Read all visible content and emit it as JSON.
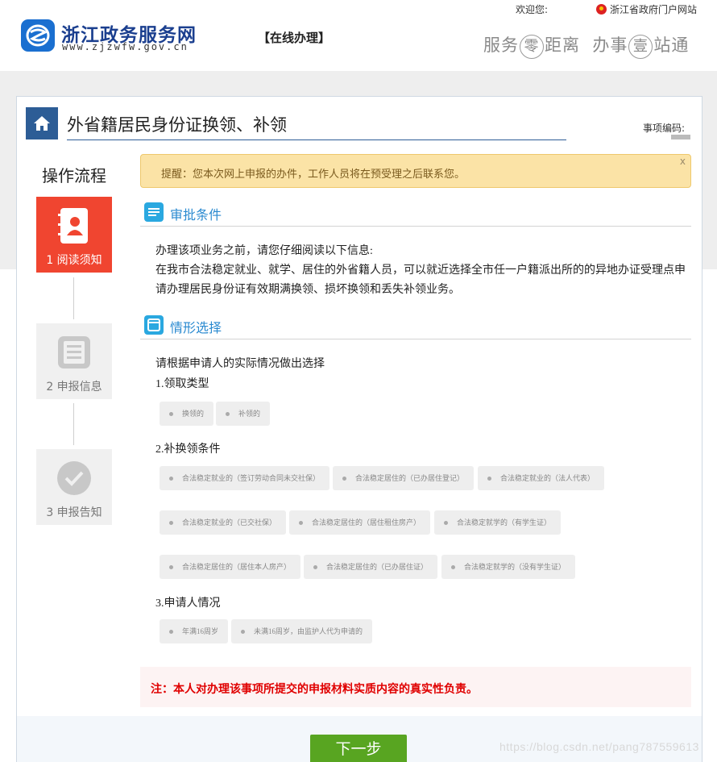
{
  "header": {
    "site_title": "浙江政务服务网",
    "site_url": "www.zjzwfw.gov.cn",
    "section_label": "【在线办理】",
    "welcome": "欢迎您:",
    "gov_portal": "浙江省政府门户网站",
    "slogan_a": "服务",
    "slogan_zero": "零",
    "slogan_b": "距离",
    "slogan_c": "办事",
    "slogan_one": "壹",
    "slogan_d": "站通",
    "brand_color": "#1b3f8f"
  },
  "page": {
    "title": "外省籍居民身份证换领、补领",
    "code_label": "事项编码:"
  },
  "steps": {
    "title": "操作流程",
    "items": [
      {
        "label": "1 阅读须知",
        "icon": "contact-book-icon",
        "state": "active"
      },
      {
        "label": "2 申报信息",
        "icon": "document-list-icon",
        "state": "inactive"
      },
      {
        "label": "3 申报告知",
        "icon": "check-circle-icon",
        "state": "inactive"
      }
    ]
  },
  "notice": {
    "text": "提醒：您本次网上申报的办件，工作人员将在预受理之后联系您。",
    "close": "x"
  },
  "approval": {
    "title": "审批条件",
    "line1": "办理该项业务之前，请您仔细阅读以下信息:",
    "line2": "在我市合法稳定就业、就学、居住的外省籍人员，可以就近选择全市任一户籍派出所的的异地办证受理点申",
    "line3": "请办理居民身份证有效期满换领、损坏换领和丢失补领业务。"
  },
  "situation": {
    "title": "情形选择",
    "intro": "请根据申请人的实际情况做出选择",
    "q1": {
      "title": "1.领取类型",
      "options": [
        "换领的",
        "补领的"
      ]
    },
    "q2": {
      "title": "2.补换领条件",
      "options": [
        "合法稳定就业的（签订劳动合同未交社保）",
        "合法稳定居住的（已办居住登记）",
        "合法稳定就业的（法人代表）",
        "合法稳定就业的（已交社保）",
        "合法稳定居住的（居住租住房产）",
        "合法稳定就学的（有学生证）",
        "合法稳定居住的（居住本人房产）",
        "合法稳定居住的（已办居住证）",
        "合法稳定就学的（没有学生证）"
      ]
    },
    "q3": {
      "title": "3.申请人情况",
      "options": [
        "年满16周岁",
        "未满16周岁，由监护人代为申请的"
      ]
    }
  },
  "disclaimer": "注：本人对办理该事项所提交的申报材料实质内容的真实性负责。",
  "next_button": "下一步",
  "watermark": "https://blog.csdn.net/pang787559613"
}
